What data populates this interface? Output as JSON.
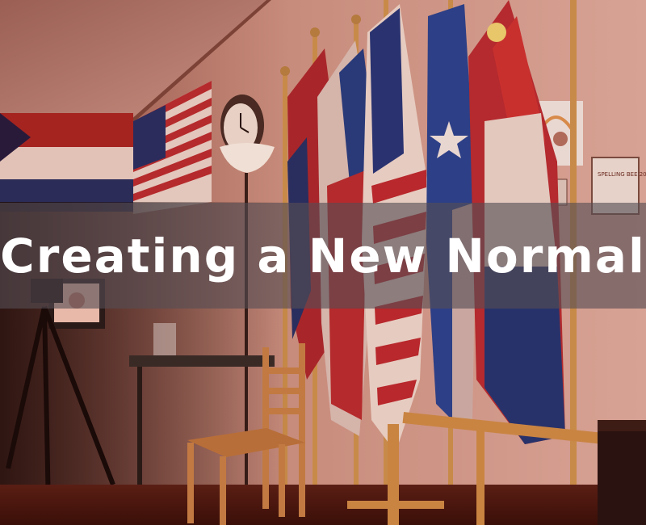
{
  "banner": {
    "title": "Creating a New Normal"
  },
  "scene": {
    "wall_color": "#c98a78",
    "floor_color": "#5a1e14",
    "ceiling_color": "#b8786a",
    "certificate_text": "SPELLING BEE 2014"
  },
  "colors": {
    "flag_red": "#b0262c",
    "flag_blue": "#28356a",
    "flag_white": "#e8cfc4",
    "wood": "#c98442",
    "banner_overlay": "rgba(85,78,84,0.62)"
  }
}
